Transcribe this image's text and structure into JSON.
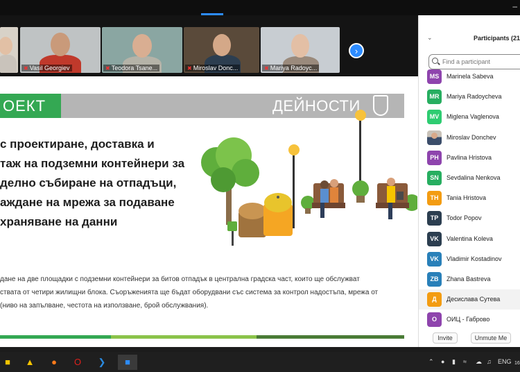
{
  "video_strip": {
    "tiles": [
      {
        "name": "",
        "bg": "#d8d2c8",
        "shirt": "#c9c3bb",
        "skin": "#e2c0a5"
      },
      {
        "name": "Vasil Georgiev",
        "bg": "#bfc3c4",
        "shirt": "#c0392b",
        "skin": "#c99a7a"
      },
      {
        "name": "Teodora Tsane...",
        "bg": "#8aa6a2",
        "shirt": "#b5b3a8",
        "skin": "#d9ae92"
      },
      {
        "name": "Miroslav Donc...",
        "bg": "#5a4a3a",
        "shirt": "#2c3e50",
        "skin": "#d4a888"
      },
      {
        "name": "Mariya Radoyc...",
        "bg": "#c8cdd2",
        "shirt": "#9a8a7c",
        "skin": "#e3bfa5"
      }
    ],
    "next_arrow": "›"
  },
  "slide": {
    "project_label": "ОЕКТ",
    "activities_label": "ДЕЙНОСТИ",
    "title_lines": [
      "с проектиране, доставка и",
      "таж на подземни контейнери за",
      "делно събиране на отпадъци,",
      "аждане на мрежа за подаване",
      "храняване на данни"
    ],
    "body_lines": [
      "дане на две площадки с подземни контейнери за битов отпадък в централна градска част, които ще обслужват",
      "ствата от четири жилищни блока. Съоръженията ще бъдат оборудвани със система за контрол надостъпа, мрежа от",
      " (ниво на запълване, честота на използване, брой обслужвания)."
    ]
  },
  "participants": {
    "title": "Participants (21",
    "search_placeholder": "Find a participant",
    "list": [
      {
        "initials": "MS",
        "name": "Marinela Sabeva",
        "color": "#8e44ad"
      },
      {
        "initials": "MR",
        "name": "Mariya Radoycheva",
        "color": "#27ae60"
      },
      {
        "initials": "MV",
        "name": "Miglena Vaglenova",
        "color": "#2ecc71"
      },
      {
        "initials": "",
        "name": "Miroslav Donchev",
        "color": "photo"
      },
      {
        "initials": "PH",
        "name": "Pavlina Hristova",
        "color": "#8e44ad"
      },
      {
        "initials": "SN",
        "name": "Sevdalina Nenkova",
        "color": "#27ae60"
      },
      {
        "initials": "TH",
        "name": "Tania Hristova",
        "color": "#f39c12"
      },
      {
        "initials": "TP",
        "name": "Todor Popov",
        "color": "#2c3e50"
      },
      {
        "initials": "VK",
        "name": "Valentina Koleva",
        "color": "#2c3e50"
      },
      {
        "initials": "VK",
        "name": "Vladimir Kostadinov",
        "color": "#2980b9"
      },
      {
        "initials": "ZB",
        "name": "Zhana Bastreva",
        "color": "#2980b9"
      },
      {
        "initials": "Д",
        "name": "Десислава Сутева",
        "color": "#f39c12"
      },
      {
        "initials": "O",
        "name": "ОИЦ - Габрово",
        "color": "#8e44ad"
      }
    ],
    "invite_label": "Invite",
    "unmute_label": "Unmute Me"
  },
  "taskbar": {
    "lang": "ENG",
    "clock": "16"
  }
}
